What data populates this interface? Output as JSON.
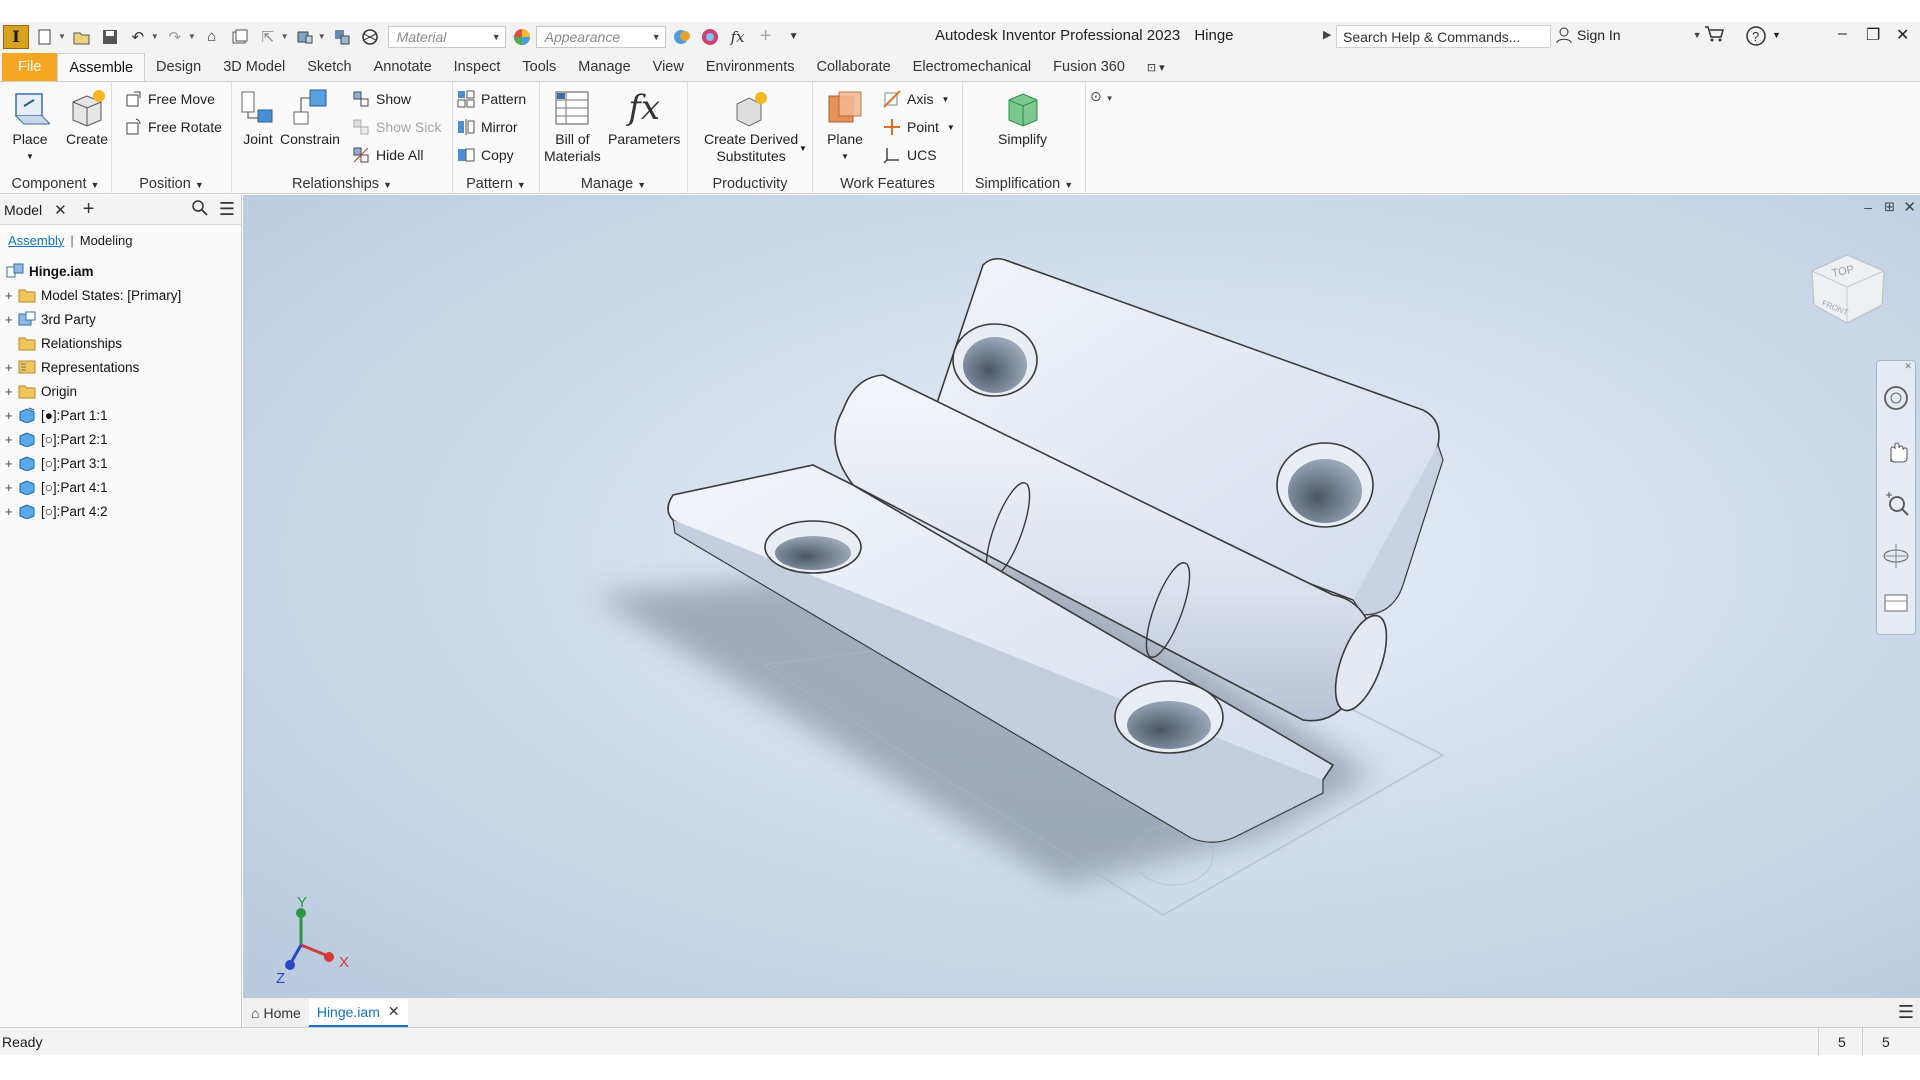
{
  "titlebar": {
    "logo": "I",
    "material_placeholder": "Material",
    "appearance_placeholder": "Appearance",
    "fx_glyph": "fx",
    "title": "Autodesk Inventor Professional 2023",
    "document": "Hinge",
    "search_placeholder": "Search Help & Commands...",
    "sign_in": "Sign In"
  },
  "tabs": [
    "File",
    "Assemble",
    "Design",
    "3D Model",
    "Sketch",
    "Annotate",
    "Inspect",
    "Tools",
    "Manage",
    "View",
    "Environments",
    "Collaborate",
    "Electromechanical",
    "Fusion 360"
  ],
  "ribbon": {
    "component": {
      "label": "Component",
      "place": "Place",
      "create": "Create"
    },
    "position": {
      "label": "Position",
      "free_move": "Free Move",
      "free_rotate": "Free Rotate"
    },
    "relationships": {
      "label": "Relationships",
      "joint": "Joint",
      "constrain": "Constrain",
      "show": "Show",
      "show_sick": "Show Sick",
      "hide_all": "Hide All"
    },
    "pattern": {
      "label": "Pattern",
      "pattern": "Pattern",
      "mirror": "Mirror",
      "copy": "Copy"
    },
    "manage": {
      "label": "Manage",
      "bom_line1": "Bill of",
      "bom_line2": "Materials",
      "parameters": "Parameters",
      "fx_glyph": "fx"
    },
    "productivity": {
      "label": "Productivity",
      "line1": "Create Derived",
      "line2": "Substitutes"
    },
    "work_features": {
      "label": "Work Features",
      "plane": "Plane",
      "axis": "Axis",
      "point": "Point",
      "ucs": "UCS"
    },
    "simplification": {
      "label": "Simplification",
      "simplify": "Simplify"
    }
  },
  "browser": {
    "tab": "Model",
    "add_glyph": "+",
    "sub_assembly": "Assembly",
    "sub_modeling": "Modeling",
    "root": "Hinge.iam",
    "items": [
      {
        "label": "Model States: [Primary]",
        "icon": "folder-icon",
        "expand": "+"
      },
      {
        "label": "3rd Party",
        "icon": "third-party-icon",
        "expand": "+"
      },
      {
        "label": "Relationships",
        "icon": "folder-icon",
        "expand": ""
      },
      {
        "label": "Representations",
        "icon": "representations-icon",
        "expand": "+"
      },
      {
        "label": "Origin",
        "icon": "folder-icon",
        "expand": "+"
      },
      {
        "label": "[●]:Part 1:1",
        "icon": "part-grounded-icon",
        "expand": "+"
      },
      {
        "label": "[○]:Part 2:1",
        "icon": "part-icon",
        "expand": "+"
      },
      {
        "label": "[○]:Part 3:1",
        "icon": "part-icon",
        "expand": "+"
      },
      {
        "label": "[○]:Part 4:1",
        "icon": "part-icon",
        "expand": "+"
      },
      {
        "label": "[○]:Part 4:2",
        "icon": "part-icon",
        "expand": "+"
      }
    ]
  },
  "viewport": {
    "viewcube_top": "TOP",
    "viewcube_front": "FRONT",
    "axis_x": "X",
    "axis_y": "Y",
    "axis_z": "Z"
  },
  "doctabs": {
    "home": "Home",
    "active": "Hinge.iam"
  },
  "status": {
    "text": "Ready",
    "count1": "5",
    "count2": "5"
  },
  "colors": {
    "file_tab": "#f5a623",
    "accent": "#1473c5",
    "logo": "#d7a21f"
  }
}
